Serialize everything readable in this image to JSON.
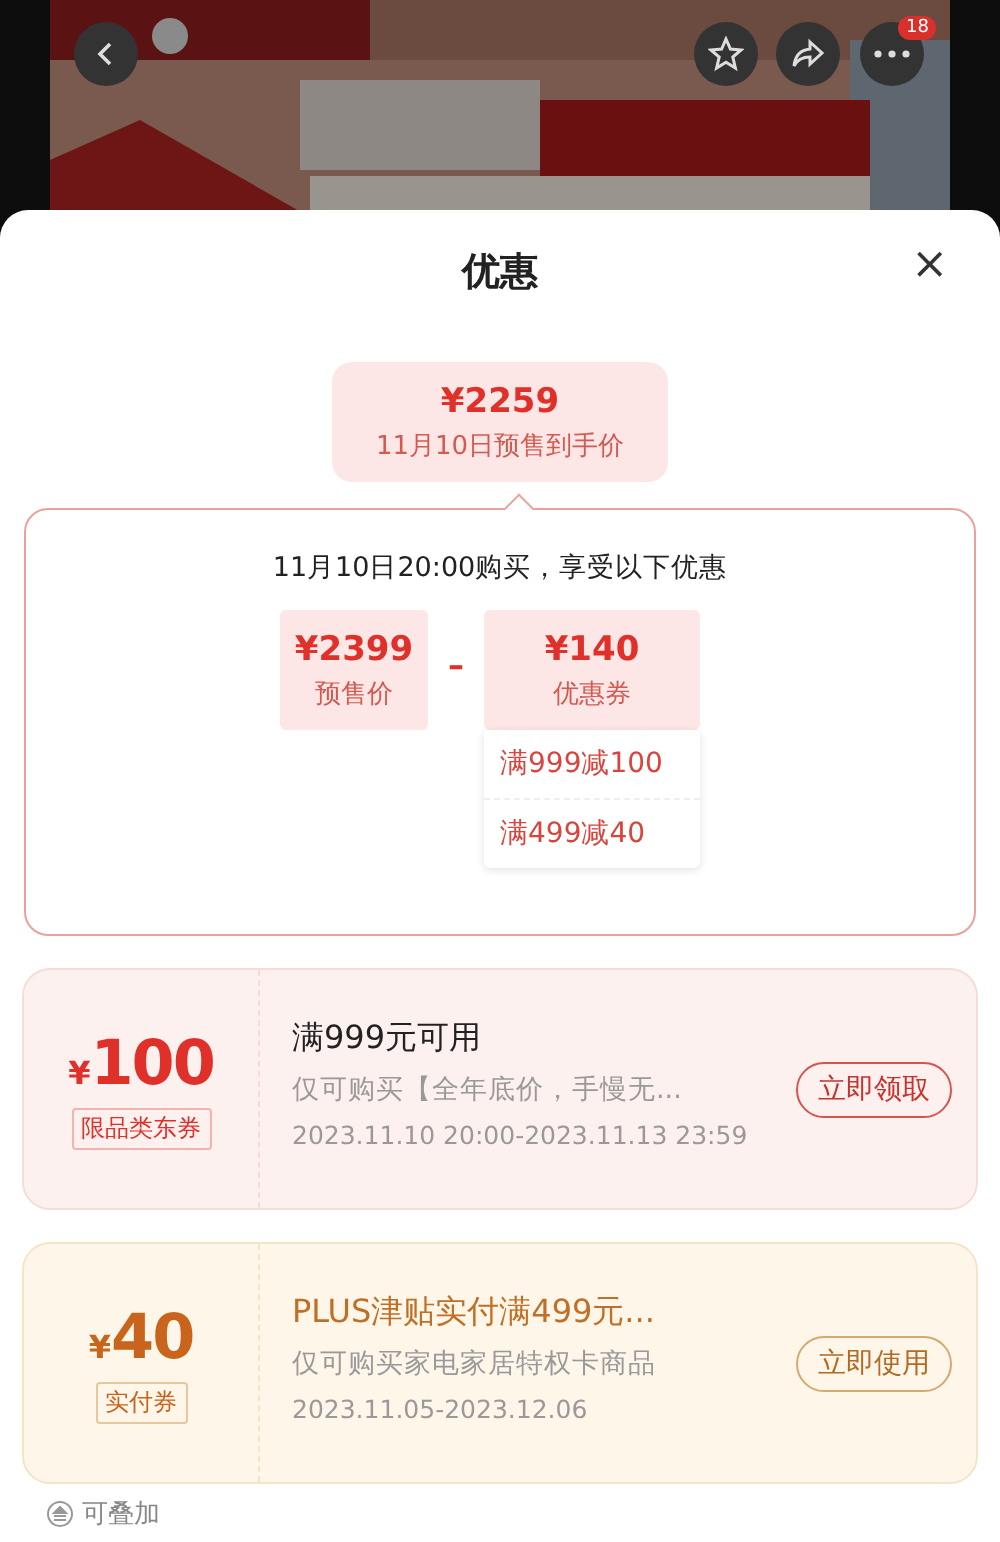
{
  "top_bar": {
    "more_badge": "18"
  },
  "sheet": {
    "title": "优惠",
    "close": "×"
  },
  "final_price": {
    "amount": "¥2259",
    "label": "11月10日预售到手价"
  },
  "breakdown": {
    "heading": "11月10日20:00购买，享受以下优惠",
    "presale": {
      "amount": "¥2399",
      "label": "预售价"
    },
    "operator": "–",
    "coupon_total": {
      "amount": "¥140",
      "label": "优惠券"
    },
    "coupon_items": [
      "满999减100",
      "满499减40"
    ]
  },
  "coupons": [
    {
      "kind": "store",
      "currency": "¥",
      "value": "100",
      "tag": "限品类东券",
      "title": "满999元可用",
      "description": "仅可购买【全年底价，手慢无...",
      "validity": "2023.11.10 20:00-2023.11.13 23:59",
      "action": "立即领取"
    },
    {
      "kind": "plus",
      "currency": "¥",
      "value": "40",
      "tag": "实付券",
      "title": "PLUS津贴实付满499元...",
      "description": "仅可购买家电家居特权卡商品",
      "validity": "2023.11.05-2023.12.06",
      "action": "立即使用",
      "note": "可叠加"
    }
  ]
}
